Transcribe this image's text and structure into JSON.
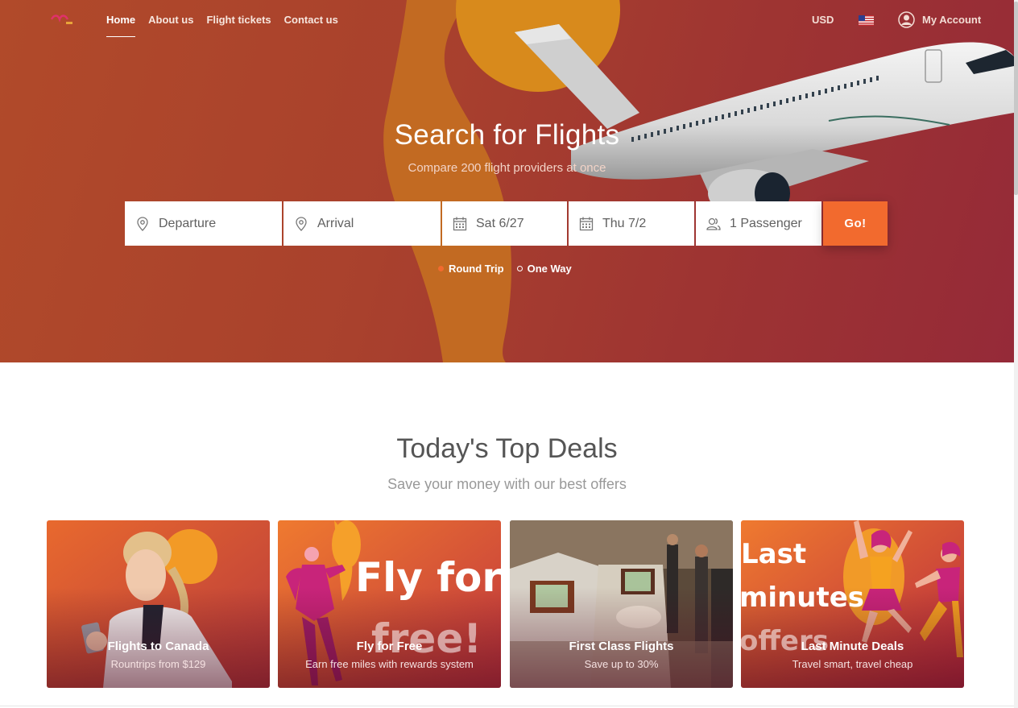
{
  "nav": {
    "links": [
      {
        "label": "Home",
        "active": true
      },
      {
        "label": "About us",
        "active": false
      },
      {
        "label": "Flight tickets",
        "active": false
      },
      {
        "label": "Contact us",
        "active": false
      }
    ],
    "currency": "USD",
    "account_label": "My Account"
  },
  "hero": {
    "title": "Search for Flights",
    "subtitle": "Compare 200 flight providers at once"
  },
  "search": {
    "departure": "Departure",
    "arrival": "Arrival",
    "depart_date": "Sat 6/27",
    "return_date": "Thu 7/2",
    "passengers": "1 Passenger",
    "go_label": "Go!",
    "trip_options": [
      {
        "label": "Round Trip",
        "selected": true
      },
      {
        "label": "One Way",
        "selected": false
      }
    ]
  },
  "deals": {
    "title": "Today's Top Deals",
    "subtitle": "Save your money with our best offers",
    "cards": [
      {
        "title": "Flights to Canada",
        "subtitle": "Rountrips from $129"
      },
      {
        "title": "Fly for Free",
        "subtitle": "Earn free miles with rewards system",
        "art_text": [
          "Fly for",
          "free!"
        ]
      },
      {
        "title": "First Class Flights",
        "subtitle": "Save up to 30%"
      },
      {
        "title": "Last Minute Deals",
        "subtitle": "Travel smart, travel cheap",
        "art_text": [
          "Last",
          "minutes",
          "offers"
        ]
      }
    ]
  },
  "colors": {
    "accent": "#f26a2e",
    "hero_bg": "#a9412d",
    "blob": "#c96a1e"
  }
}
